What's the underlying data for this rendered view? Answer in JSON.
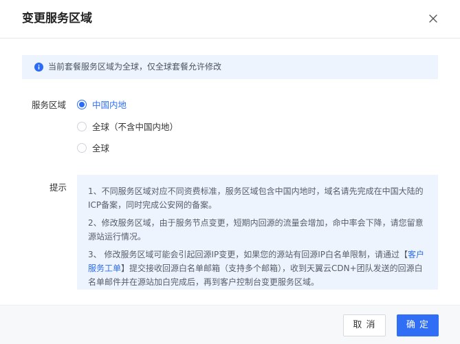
{
  "dialog": {
    "title": "变更服务区域",
    "close_icon": "close-icon"
  },
  "info": {
    "icon": "info-icon",
    "text": "当前套餐服务区域为全球，仅全球套餐允许修改"
  },
  "service_area": {
    "label": "服务区域",
    "options": [
      {
        "label": "中国内地",
        "checked": true
      },
      {
        "label": "全球（不含中国内地）",
        "checked": false
      },
      {
        "label": "全球",
        "checked": false
      }
    ]
  },
  "tips": {
    "label": "提示",
    "items": [
      "1、不同服务区域对应不同资费标准，服务区域包含中国内地时，域名请先完成在中国大陆的ICP备案，同时完成公安网的备案。",
      "2、修改服务区域，由于服务节点变更，短期内回源的流量会增加，命中率会下降，请您留意源站运行情况。"
    ],
    "item3": {
      "before": "3、 修改服务区域可能会引起回源IP变更，如果您的源站有回源IP白名单限制，请通过【",
      "link": "客户服务工单",
      "after": "】提交接收回源白名单邮箱（支持多个邮箱），收到天翼云CDN+团队发送的回源白名单邮件并在源站加白完成后，再到客户控制台变更服务区域。"
    }
  },
  "footer": {
    "cancel_label": "取 消",
    "confirm_label": "确 定"
  },
  "colors": {
    "accent": "#2b6cf6",
    "banner_bg": "#eef4fd"
  }
}
